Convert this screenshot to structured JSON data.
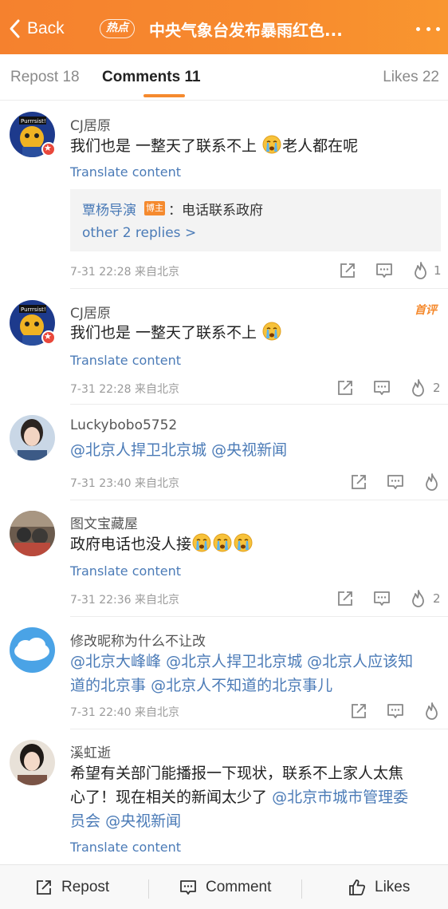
{
  "header": {
    "back_label": "Back",
    "hot_badge": "热点",
    "title": "中央气象台发布暴雨红色...",
    "accent_color": "#f78a2e"
  },
  "tabs": [
    {
      "label": "Repost 18",
      "active": false
    },
    {
      "label": "Comments 11",
      "active": true
    },
    {
      "label": "Likes 22",
      "active": false
    }
  ],
  "comments": [
    {
      "username": "CJ居原",
      "text_before": "我们也是 一整天了联系不上",
      "emoji": "crying-face",
      "text_after": "老人都在呢",
      "translate": "Translate content",
      "reply": {
        "author": "覃杨导演",
        "badge": "博主",
        "text": "：电话联系政府",
        "more": "other 2 replies >"
      },
      "time": "7-31 22:28",
      "location": "来自北京",
      "likes": "1"
    },
    {
      "username": "CJ居原",
      "tag": "首评",
      "text_before": "我们也是 一整天了联系不上",
      "emoji": "crying-face",
      "translate": "Translate content",
      "time": "7-31 22:28",
      "location": "来自北京",
      "likes": "2"
    },
    {
      "username": "Luckybobo5752",
      "mentions": [
        "@北京人捍卫北京城",
        "@央视新闻"
      ],
      "time": "7-31 23:40",
      "location": "来自北京"
    },
    {
      "username": "图文宝藏屋",
      "text_before": "政府电话也没人接",
      "emoji": "crying-face",
      "translate": "Translate content",
      "time": "7-31 22:36",
      "location": "来自北京",
      "likes": "2"
    },
    {
      "username": "修改昵称为什么不让改",
      "mentions": [
        "@北京大峰峰",
        "@北京人捍卫北京城",
        "@北京人应该知",
        "道的北京事",
        "@北京人不知道的北京事儿"
      ],
      "time": "7-31 22:40",
      "location": "来自北京"
    },
    {
      "username": "溪虹逝",
      "text_line1": "希望有关部门能播报一下现状，联系不上家人太焦",
      "text_line2": "心了！现在相关的新闻太少了",
      "mention1": "@北京市城市管理委",
      "mention2": "员会",
      "mention3": "@央视新闻",
      "translate": "Translate content"
    }
  ],
  "bottom_bar": {
    "repost_label": "Repost",
    "comment_label": "Comment",
    "likes_label": "Likes"
  }
}
